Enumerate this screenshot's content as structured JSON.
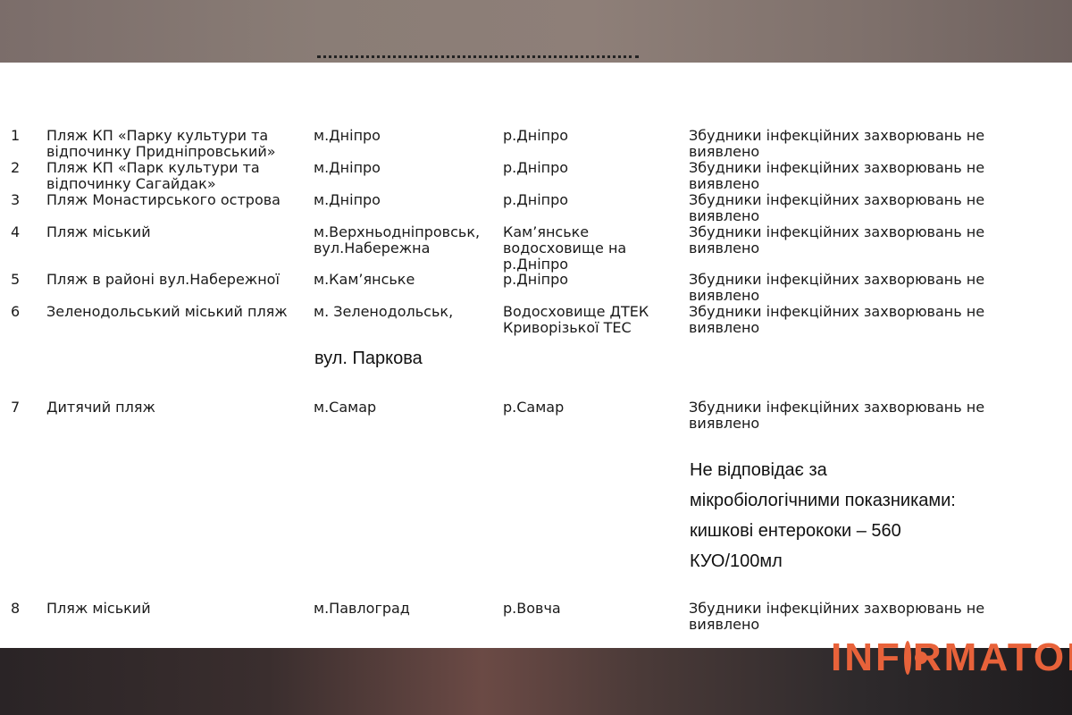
{
  "rows": [
    {
      "num": "1",
      "name_lines": [
        "Пляж КП «Парку культури та",
        "відпочинку Придніпровський»"
      ],
      "city_lines": [
        "м.Дніпро"
      ],
      "water_lines": [
        "р.Дніпро"
      ],
      "result_lines": [
        "Збудники інфекційних захворювань не",
        "виявлено"
      ]
    },
    {
      "num": "2",
      "name_lines": [
        "Пляж КП «Парк  культури та",
        "відпочинку Сагайдак»"
      ],
      "city_lines": [
        "м.Дніпро"
      ],
      "water_lines": [
        "р.Дніпро"
      ],
      "result_lines": [
        "Збудники інфекційних захворювань не",
        "виявлено"
      ]
    },
    {
      "num": "3",
      "name_lines": [
        "Пляж Монастирського острова"
      ],
      "city_lines": [
        "м.Дніпро"
      ],
      "water_lines": [
        "р.Дніпро"
      ],
      "result_lines": [
        "Збудники інфекційних захворювань не",
        "виявлено"
      ]
    },
    {
      "num": "4",
      "name_lines": [
        "Пляж міський"
      ],
      "city_lines": [
        "м.Верхньодніпровськ,",
        "вул.Набережна"
      ],
      "water_lines": [
        "Кам’янське",
        "водосховище на",
        "р.Дніпро"
      ],
      "result_lines": [
        "Збудники інфекційних захворювань не",
        "виявлено"
      ]
    },
    {
      "num": "5",
      "name_lines": [
        "Пляж в районі вул.Набережної"
      ],
      "city_lines": [
        "м.Кам’янське"
      ],
      "water_lines": [
        "р.Дніпро"
      ],
      "result_lines": [
        "Збудники інфекційних захворювань не",
        "виявлено"
      ]
    },
    {
      "num": "6",
      "name_lines": [
        "Зеленодольський міський пляж"
      ],
      "city_lines": [
        "м. Зеленодольськ,"
      ],
      "water_lines": [
        "Водосховище ДТЕК",
        "Криворізької ТЕС"
      ],
      "result_lines": [
        "Збудники інфекційних захворювань не",
        "виявлено"
      ],
      "city_extra": "вул. Паркова"
    },
    {
      "num": "7",
      "name_lines": [
        "Дитячий пляж"
      ],
      "city_lines": [
        "м.Самар"
      ],
      "water_lines": [
        "р.Самар"
      ],
      "result_lines": [
        "Збудники інфекційних захворювань не",
        "виявлено"
      ],
      "note_lines": [
        "Не відповідає за",
        "мікробіологічними показниками:",
        "кишкові ентерококи – 560",
        "КУО/100мл"
      ]
    },
    {
      "num": "8",
      "name_lines": [
        "Пляж міський"
      ],
      "city_lines": [
        "м.Павлоград"
      ],
      "water_lines": [
        "р.Вовча"
      ],
      "result_lines": [
        "Збудники інфекційних захворювань не",
        "виявлено"
      ]
    }
  ],
  "logo": {
    "part1": "INF",
    "part2": "RMATOR",
    "color": "#e8623a"
  }
}
